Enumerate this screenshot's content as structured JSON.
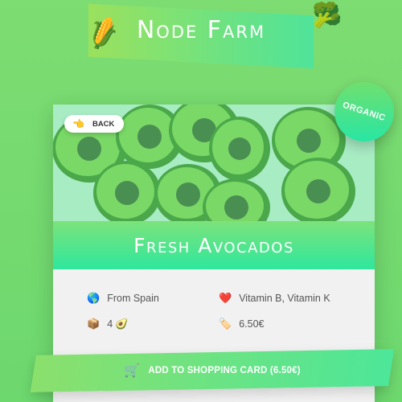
{
  "header": {
    "title": "Node Farm",
    "left_emoji": "🌽",
    "right_emoji": "🥦"
  },
  "back_button": {
    "icon": "👈",
    "label": "BACK"
  },
  "badge": {
    "label": "ORGANIC"
  },
  "product": {
    "name": "Fresh Avocados",
    "hero_image": "avocado-pattern",
    "origin_icon": "🌎",
    "origin": "From Spain",
    "nutrients_icon": "❤️",
    "nutrients": "Vitamin B, Vitamin K",
    "quantity_icon": "📦",
    "quantity": "4 🥑",
    "price_icon": "🏷️",
    "price": "6.50€"
  },
  "cart_button": {
    "icon": "🛒",
    "label": "ADD TO SHOPPING CARD (6.50€)"
  },
  "colors": {
    "background": "#6dd86e",
    "accent_start": "#9be15d",
    "accent_end": "#2ee79e",
    "card": "#ffffff",
    "details_bg": "#f1f1f1"
  }
}
